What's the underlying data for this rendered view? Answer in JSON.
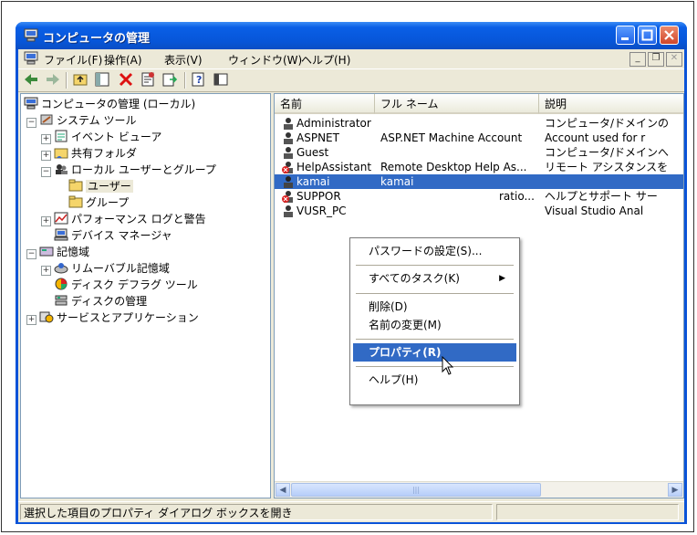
{
  "window": {
    "title": "コンピュータの管理"
  },
  "menubar": {
    "items": [
      "ファイル(F)",
      "操作(A)",
      "表示(V)",
      "ウィンドウ(W)",
      "ヘルプ(H)"
    ]
  },
  "toolbar": {
    "tools": [
      "back-arrow-icon",
      "forward-arrow-icon",
      "up-folder-icon",
      "show-tree-icon",
      "delete-icon",
      "properties-icon",
      "export-icon",
      "help-icon",
      "console-icon"
    ]
  },
  "tree": {
    "root": "コンピュータの管理 (ローカル)",
    "items": [
      "システム ツール",
      "イベント ビューア",
      "共有フォルダ",
      "ローカル ユーザーとグループ",
      "ユーザー",
      "グループ",
      "パフォーマンス ログと警告",
      "デバイス マネージャ",
      "記憶域",
      "リムーバブル記憶域",
      "ディスク デフラグ ツール",
      "ディスクの管理",
      "サービスとアプリケーション"
    ]
  },
  "list": {
    "columns": [
      "名前",
      "フル ネーム",
      "説明"
    ],
    "rows": [
      {
        "name": "Administrator",
        "fullname": "",
        "desc": "コンピュータ/ドメインの"
      },
      {
        "name": "ASPNET",
        "fullname": "ASP.NET Machine Account",
        "desc": "Account used for r"
      },
      {
        "name": "Guest",
        "fullname": "",
        "desc": "コンピュータ/ドメインへ"
      },
      {
        "name": "HelpAssistant",
        "fullname": "Remote Desktop Help As...",
        "desc": "リモート アシスタンスを"
      },
      {
        "name": "kamai",
        "fullname": "kamai",
        "desc": ""
      },
      {
        "name": "SUPPOR",
        "fullname": "ratio...",
        "desc": "ヘルプとサポート サー"
      },
      {
        "name": "VUSR_PC",
        "fullname": "",
        "desc": "Visual Studio Anal"
      }
    ]
  },
  "context_menu": {
    "set_password": "パスワードの設定(S)...",
    "all_tasks": "すべてのタスク(K)",
    "delete": "削除(D)",
    "rename": "名前の変更(M)",
    "properties": "プロパティ(R)",
    "help": "ヘルプ(H)"
  },
  "status": {
    "text": "選択した項目のプロパティ ダイアログ ボックスを開き"
  },
  "colors": {
    "titlebar": "#0756d9",
    "selection": "#316ac5",
    "close": "#d1462a"
  }
}
